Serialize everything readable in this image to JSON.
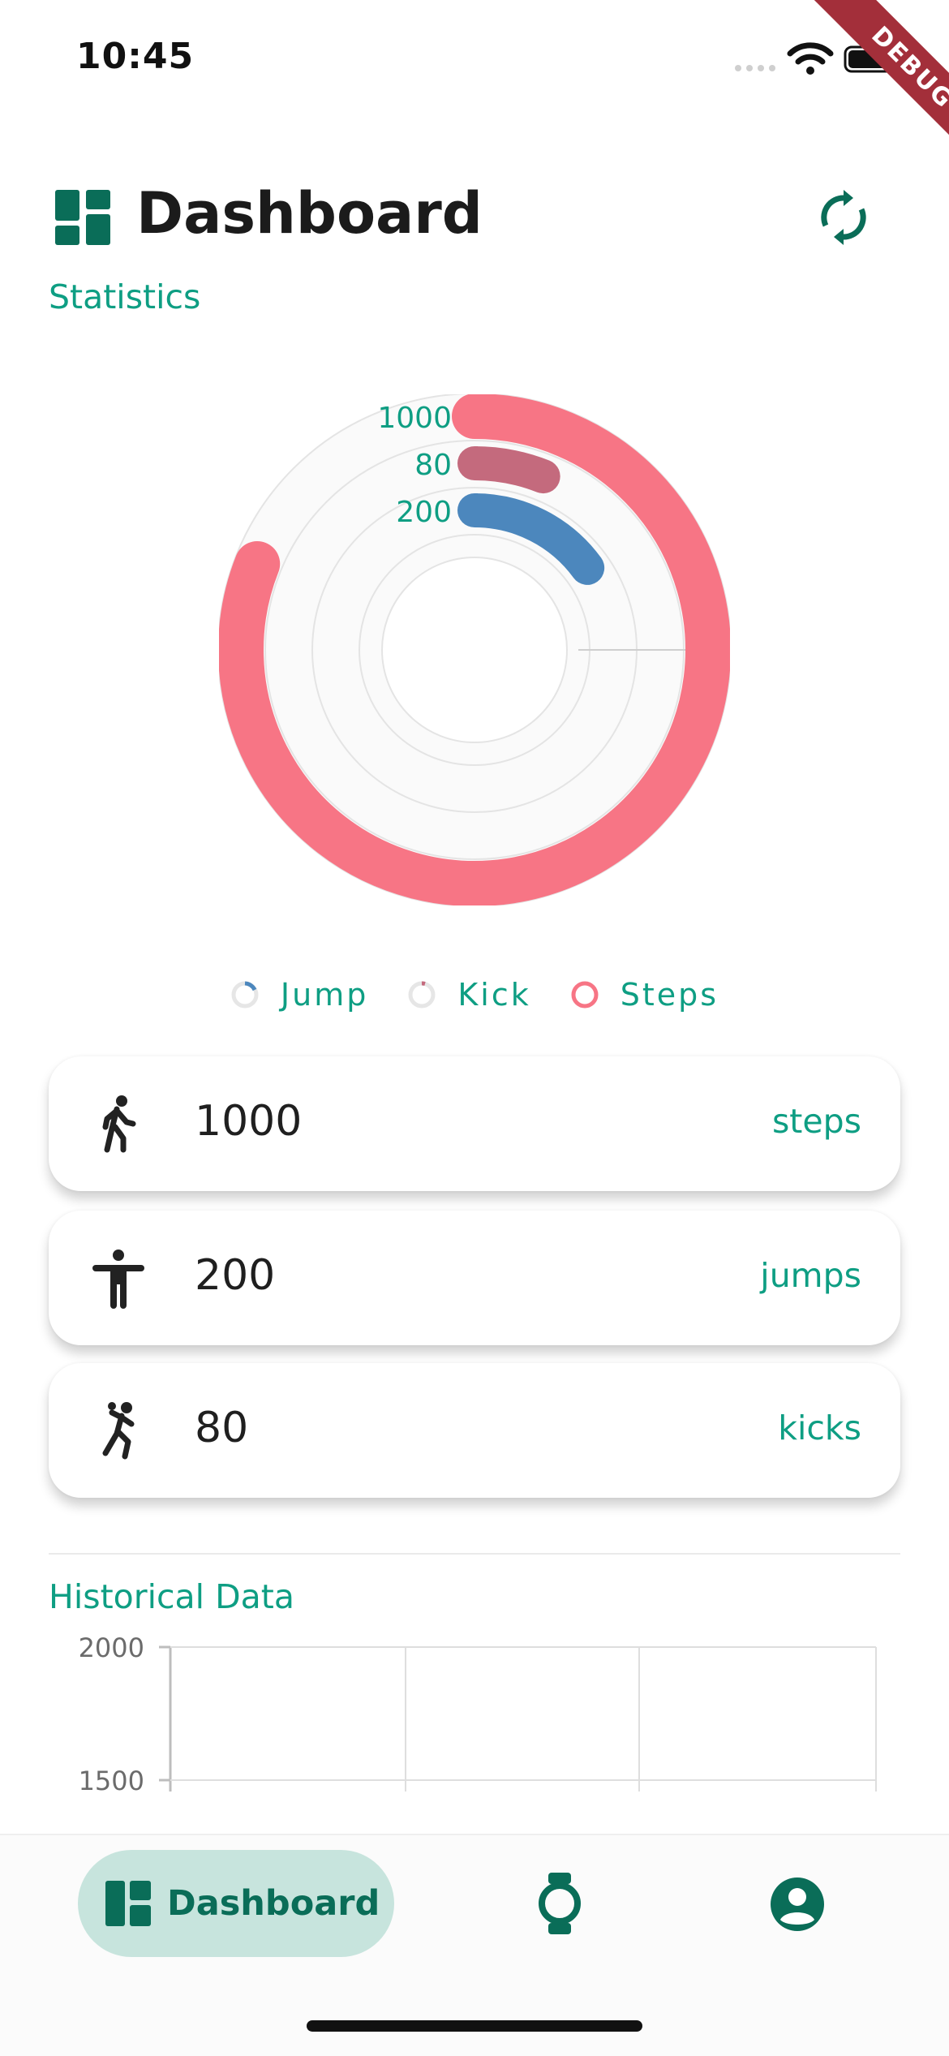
{
  "status_bar": {
    "time": "10:45"
  },
  "debug_banner": "DEBUG",
  "header": {
    "title": "Dashboard",
    "icon": "dashboard-icon",
    "action_icon": "sync-icon"
  },
  "statistics": {
    "label": "Statistics",
    "chart_data": {
      "type": "radial_bar",
      "rings": [
        {
          "name": "Steps",
          "value": 1000,
          "color": "#f77585",
          "fraction": 0.81
        },
        {
          "name": "Kick",
          "value": 80,
          "color": "#c46a7d",
          "fraction": 0.06
        },
        {
          "name": "Jump",
          "value": 200,
          "color": "#4c87bd",
          "fraction": 0.15
        }
      ],
      "ring_labels": [
        "1000",
        "80",
        "200"
      ],
      "legend": [
        "Jump",
        "Kick",
        "Steps"
      ]
    }
  },
  "cards": [
    {
      "icon": "walking-icon",
      "value": "1000",
      "unit": "steps"
    },
    {
      "icon": "jump-icon",
      "value": "200",
      "unit": "jumps"
    },
    {
      "icon": "kick-icon",
      "value": "80",
      "unit": "kicks"
    }
  ],
  "historical": {
    "label": "Historical Data",
    "chart_data": {
      "type": "line",
      "y_ticks": [
        "2000",
        "1500"
      ],
      "ylim": [
        1500,
        2000
      ],
      "series": []
    }
  },
  "nav": {
    "active_label": "Dashboard",
    "items": [
      "dashboard-icon",
      "watch-icon",
      "profile-icon"
    ]
  },
  "colors": {
    "accent": "#0e9e83",
    "accent_dark": "#0a6d58",
    "pill": "#c7e4dd"
  }
}
